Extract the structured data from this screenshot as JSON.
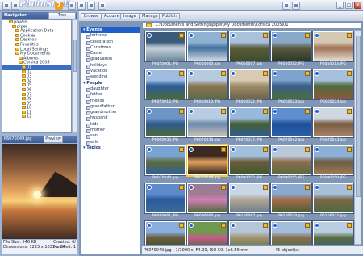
{
  "app": {
    "title_logo": "PhotoStudio",
    "version_badge": "7"
  },
  "navigator": {
    "title": "Navigator",
    "mode_button": "Tree"
  },
  "tree": [
    {
      "label": "pavelis",
      "indent": 4
    },
    {
      "label": "piper",
      "indent": 5
    },
    {
      "label": "Application Data",
      "indent": 6
    },
    {
      "label": "Cookies",
      "indent": 6
    },
    {
      "label": "Desktop",
      "indent": 6
    },
    {
      "label": "Favorites",
      "indent": 6
    },
    {
      "label": "Local Settings",
      "indent": 6
    },
    {
      "label": "My Documents",
      "indent": 6
    },
    {
      "label": "Albums",
      "indent": 7
    },
    {
      "label": "Corsica 2005",
      "indent": 7
    },
    {
      "label": "01",
      "indent": 8,
      "selected": true
    },
    {
      "label": "02",
      "indent": 8
    },
    {
      "label": "03",
      "indent": 8
    },
    {
      "label": "04",
      "indent": 8
    },
    {
      "label": "05",
      "indent": 8
    },
    {
      "label": "06",
      "indent": 8
    },
    {
      "label": "07",
      "indent": 8
    },
    {
      "label": "08",
      "indent": 8
    },
    {
      "label": "09",
      "indent": 8
    },
    {
      "label": "10",
      "indent": 8
    },
    {
      "label": "11",
      "indent": 8
    },
    {
      "label": "12",
      "indent": 8
    }
  ],
  "preview": {
    "filename": "P6070049.jpg",
    "mode_button": "Preview"
  },
  "info": {
    "file_size": "File Size: 546 KB",
    "dimensions": "Dimensions: 1223 x 1631 x 24",
    "created": "Created: 6/",
    "modified": "Modified: 1"
  },
  "toolbar": {
    "browse": "Browse",
    "acquire": "Acquire",
    "image": "Image",
    "manage": "Manage",
    "publish": "Publish"
  },
  "categories": [
    {
      "label": "Events",
      "head": true,
      "selected": true
    },
    {
      "label": "birthday"
    },
    {
      "label": "celebration"
    },
    {
      "label": "Christmas"
    },
    {
      "label": "Easter"
    },
    {
      "label": "graduation"
    },
    {
      "label": "holidays"
    },
    {
      "label": "vacation"
    },
    {
      "label": "wedding"
    },
    {
      "label": "People",
      "head": true
    },
    {
      "label": "daughter"
    },
    {
      "label": "father"
    },
    {
      "label": "friends"
    },
    {
      "label": "grandfather"
    },
    {
      "label": "grandmother"
    },
    {
      "label": "husband"
    },
    {
      "label": "kids"
    },
    {
      "label": "mother"
    },
    {
      "label": "son"
    },
    {
      "label": "wife"
    },
    {
      "label": "Topics",
      "head": true
    }
  ],
  "path": "C:\\Documents and Settings\\piper\\My Documents\\Corsica 2005\\01",
  "thumbnails": [
    {
      "name": "P6050001.JPG",
      "colors": [
        "#3c5a7a",
        "#c8d3dc",
        "#6f8a9c"
      ]
    },
    {
      "name": "P6050003.jpg",
      "colors": [
        "#8fb2d3",
        "#3f6f9a",
        "#cfd9e3"
      ]
    },
    {
      "name": "P6050007.jpg",
      "colors": [
        "#a9c1da",
        "#5e5b3b",
        "#3d4d2a"
      ]
    },
    {
      "name": "P6050012.JPG",
      "colors": [
        "#8aa8c8",
        "#5d5a40",
        "#2d3a2b"
      ]
    },
    {
      "name": "P6050013.JPG",
      "colors": [
        "#d4c9b2",
        "#a07055",
        "#e3dcd2"
      ]
    },
    {
      "name": "P6050016.JPG",
      "colors": [
        "#9fbce0",
        "#2b5b9c",
        "#4a6a3a"
      ]
    },
    {
      "name": "P6060019.JPG",
      "colors": [
        "#b6cbe0",
        "#8c7553",
        "#5c6c45"
      ]
    },
    {
      "name": "P6060022.JPG",
      "colors": [
        "#d8cbb4",
        "#9e8c6a",
        "#6f6646"
      ]
    },
    {
      "name": "P6060023.jpg",
      "colors": [
        "#7ea3cc",
        "#3a5f8f",
        "#496d3d"
      ]
    },
    {
      "name": "P6060024.jpg",
      "colors": [
        "#a7c0dd",
        "#4e6b3d",
        "#8a5a3c"
      ]
    },
    {
      "name": "P6060033.JPG",
      "colors": [
        "#6d95c6",
        "#2e5b8d",
        "#4b6a3a"
      ]
    },
    {
      "name": "P6070034.jpg",
      "colors": [
        "#b8cde4",
        "#6b8aa9",
        "#c8c2b5"
      ]
    },
    {
      "name": "P6070037.JPG",
      "colors": [
        "#98b8dc",
        "#445f2f",
        "#2f5d94"
      ]
    },
    {
      "name": "P6070042.jpg",
      "colors": [
        "#5f8fd0",
        "#1f4f98",
        "#2c5fa8"
      ]
    },
    {
      "name": "P6070043.jpg",
      "colors": [
        "#cfd7e0",
        "#7a5b43",
        "#a58469"
      ]
    },
    {
      "name": "P6070044.jpg",
      "colors": [
        "#79a3d2",
        "#5e6b3a",
        "#2f5f9a"
      ]
    },
    {
      "name": "P6070049.jpg",
      "colors": [
        "#3a2a22",
        "#e5a45f",
        "#2b1f1b"
      ],
      "selected": true
    },
    {
      "name": "P6090052.JPG",
      "colors": [
        "#a3bfdc",
        "#6b5a3d",
        "#3e5b2b"
      ]
    },
    {
      "name": "P6090055.JPG",
      "colors": [
        "#b9c9da",
        "#8e6c4e",
        "#5a6b3e"
      ]
    },
    {
      "name": "P6090059.JPG",
      "colors": [
        "#8db0d6",
        "#6a5c41",
        "#a07a56"
      ]
    },
    {
      "name": "P6080061.JPG",
      "colors": [
        "#5c8acb",
        "#2c5b9c",
        "#3b6a9a"
      ]
    },
    {
      "name": "P6090064.jpg",
      "colors": [
        "#9b7c92",
        "#d17fb3",
        "#4d6b38"
      ]
    },
    {
      "name": "P6100067.jpg",
      "colors": [
        "#c8d6e6",
        "#b2a692",
        "#6a7f8f"
      ]
    },
    {
      "name": "P6100070.jpg",
      "colors": [
        "#8aa9cc",
        "#a36c4a",
        "#4b5f37"
      ]
    },
    {
      "name": "P6100072.jpg",
      "colors": [
        "#a8bfd8",
        "#7a6848",
        "#4e6a3f"
      ]
    },
    {
      "name": "",
      "colors": [
        "#89aede",
        "#6a5d3e",
        "#3c4f2a"
      ]
    },
    {
      "name": "",
      "colors": [
        "#6e9a4f",
        "#c85a8a",
        "#3e6a2e"
      ]
    },
    {
      "name": "",
      "colors": [
        "#b5c6d8",
        "#a2946f",
        "#5a6d4a"
      ]
    },
    {
      "name": "",
      "colors": [
        "#a4bddb",
        "#867052",
        "#4f6a3a"
      ]
    },
    {
      "name": "",
      "colors": [
        "#b9cde2",
        "#596e41",
        "#3b5a7c"
      ]
    }
  ],
  "status": {
    "text": "P6070049.jpg - 1/1000 s, F4.00, ISO 50, 1x6.59 mm",
    "count": "45 object(s)"
  }
}
